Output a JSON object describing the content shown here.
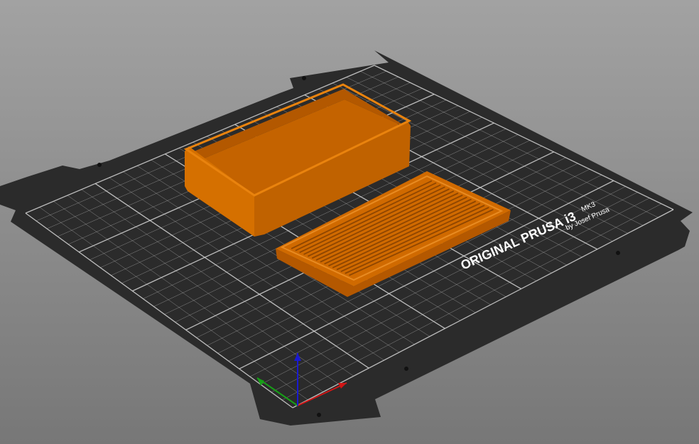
{
  "viewport": {
    "background_top": "#a2a2a2",
    "background_bottom": "#777777"
  },
  "bed": {
    "plate_color": "#2b2b2b",
    "grid_color": "#d6d6d6",
    "text_line1": "ORIGINAL PRUSA i3",
    "text_model": "MK3",
    "text_line2": "by Josef Prusa"
  },
  "objects": {
    "color": "#d06a00",
    "items": [
      {
        "name": "Box"
      },
      {
        "name": "Lid"
      }
    ]
  },
  "axes": {
    "x_color": "#d01515",
    "y_color": "#17a017",
    "z_color": "#1a1ad0"
  }
}
